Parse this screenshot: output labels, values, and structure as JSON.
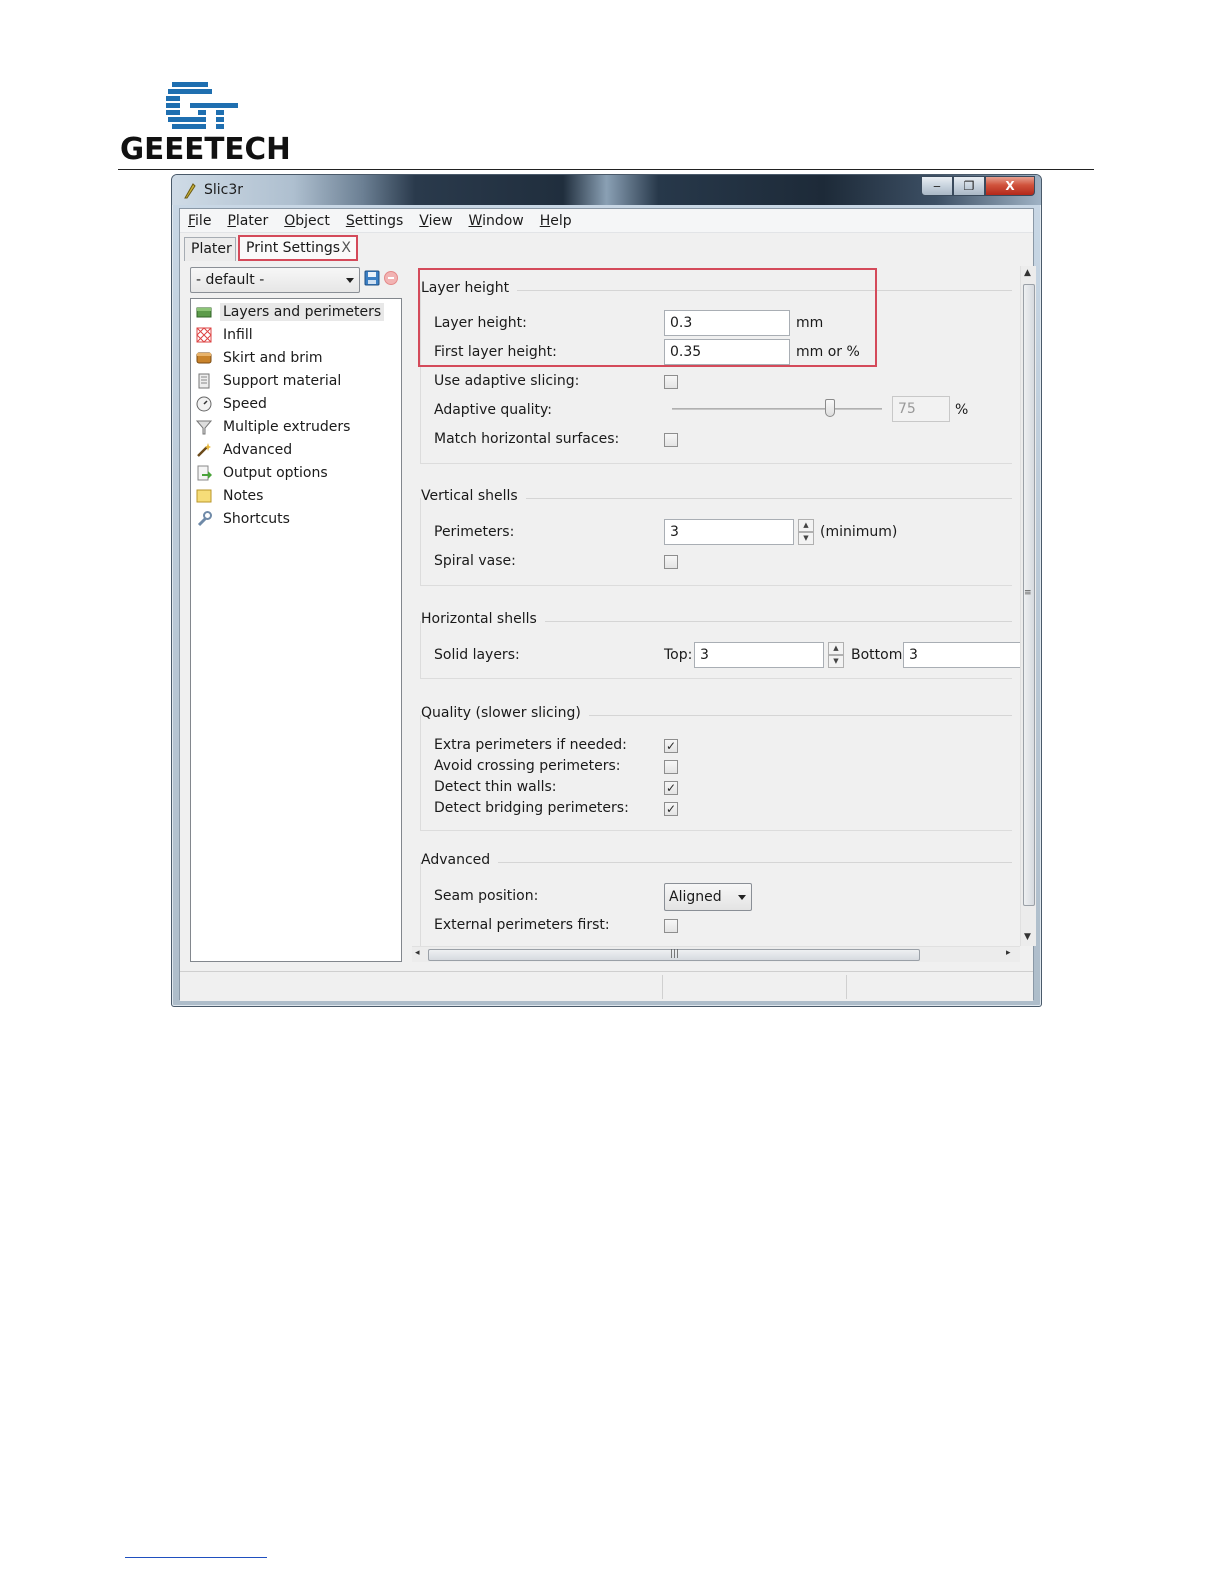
{
  "document": {
    "logo_text": "GEEETECH"
  },
  "window": {
    "title": "Slic3r",
    "controls": {
      "minimize": "‒",
      "maximize": "❐",
      "close": "X"
    }
  },
  "menu": [
    {
      "label": "File",
      "underline": "F",
      "rest": "ile"
    },
    {
      "label": "Plater",
      "underline": "P",
      "rest": "later"
    },
    {
      "label": "Object",
      "underline": "O",
      "rest": "bject"
    },
    {
      "label": "Settings",
      "underline": "S",
      "rest": "ettings"
    },
    {
      "label": "View",
      "underline": "V",
      "rest": "iew"
    },
    {
      "label": "Window",
      "underline": "W",
      "rest": "indow"
    },
    {
      "label": "Help",
      "underline": "H",
      "rest": "elp"
    }
  ],
  "tabs": {
    "plater": "Plater",
    "print_settings": "Print Settings",
    "close": "X"
  },
  "preset": {
    "value": "- default -"
  },
  "tree": [
    {
      "label": "Layers and perimeters",
      "icon": "layers-icon",
      "selected": true
    },
    {
      "label": "Infill",
      "icon": "infill-icon"
    },
    {
      "label": "Skirt and brim",
      "icon": "skirt-icon"
    },
    {
      "label": "Support material",
      "icon": "support-icon"
    },
    {
      "label": "Speed",
      "icon": "speed-icon"
    },
    {
      "label": "Multiple extruders",
      "icon": "funnel-icon"
    },
    {
      "label": "Advanced",
      "icon": "wand-icon"
    },
    {
      "label": "Output options",
      "icon": "output-icon"
    },
    {
      "label": "Notes",
      "icon": "note-icon"
    },
    {
      "label": "Shortcuts",
      "icon": "wrench-icon"
    }
  ],
  "groups": {
    "layer_height": {
      "title": "Layer height",
      "layer_height_label": "Layer height:",
      "layer_height_value": "0.3",
      "layer_height_unit": "mm",
      "first_layer_label": "First layer height:",
      "first_layer_value": "0.35",
      "first_layer_unit": "mm or %",
      "adaptive_slicing_label": "Use adaptive slicing:",
      "adaptive_quality_label": "Adaptive quality:",
      "adaptive_quality_value": "75",
      "adaptive_quality_unit": "%",
      "adaptive_quality_slider_fraction": 0.75,
      "match_horizontal_label": "Match horizontal surfaces:"
    },
    "vertical_shells": {
      "title": "Vertical shells",
      "perimeters_label": "Perimeters:",
      "perimeters_value": "3",
      "perimeters_unit": "(minimum)",
      "spiral_vase_label": "Spiral vase:"
    },
    "horizontal_shells": {
      "title": "Horizontal shells",
      "solid_layers_label": "Solid layers:",
      "top_label": "Top:",
      "top_value": "3",
      "bottom_label": "Bottom:",
      "bottom_value": "3"
    },
    "quality": {
      "title": "Quality (slower slicing)",
      "extra_perimeters_label": "Extra perimeters if needed:",
      "extra_perimeters_checked": true,
      "avoid_crossing_label": "Avoid crossing perimeters:",
      "avoid_crossing_checked": false,
      "thin_walls_label": "Detect thin walls:",
      "thin_walls_checked": true,
      "bridging_label": "Detect bridging perimeters:",
      "bridging_checked": true
    },
    "advanced": {
      "title": "Advanced",
      "seam_position_label": "Seam position:",
      "seam_position_value": "Aligned",
      "external_first_label": "External perimeters first:"
    }
  },
  "glyphs": {
    "check": "✓",
    "up": "▲",
    "down": "▼",
    "left": "◂",
    "right": "▸",
    "grip_h": "|||",
    "grip_v": "≡"
  },
  "colors": {
    "highlight": "#d44a5a",
    "brand": "#1f6fb0"
  }
}
